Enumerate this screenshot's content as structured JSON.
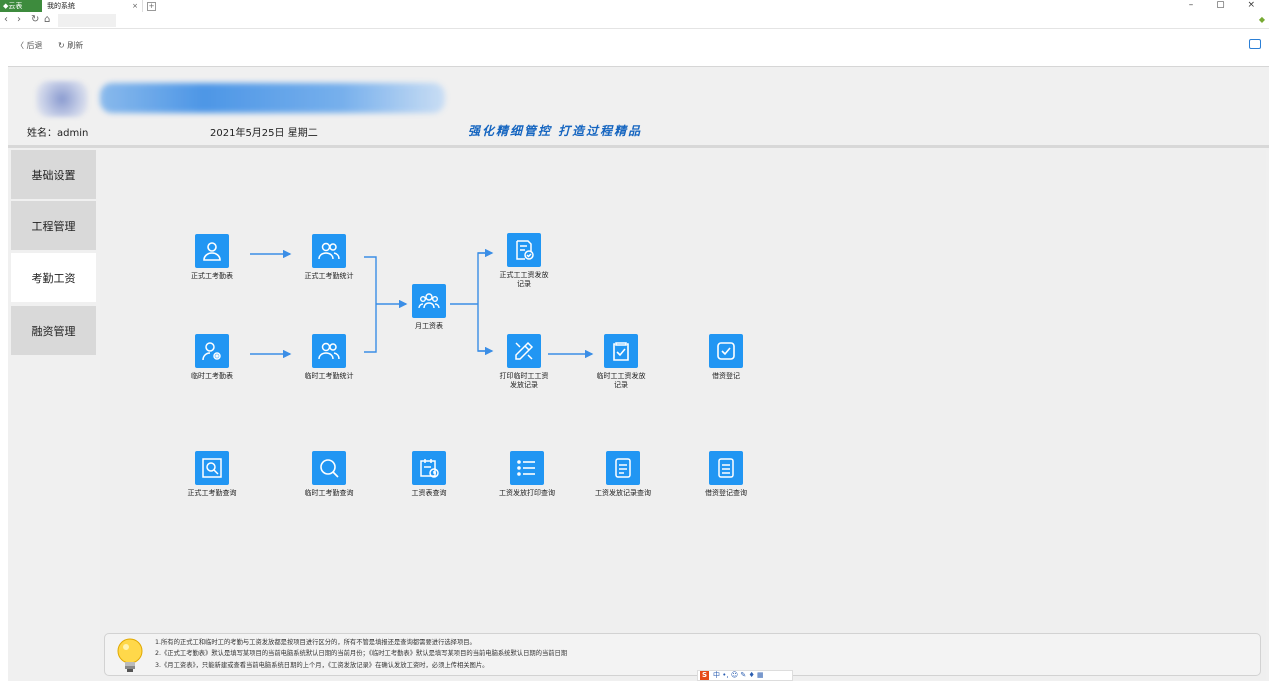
{
  "browser": {
    "tab_home": "◆云表",
    "tab_active": "我的系统",
    "tab_close": "×",
    "window_controls": "–  ▢  ×",
    "nav_back": "‹",
    "nav_forward": "›",
    "nav_refresh": "↻",
    "nav_home": "⌂",
    "toolbar_back": "〈 后退",
    "toolbar_refresh": "↻ 刷新"
  },
  "header": {
    "user_label": "姓名：admin",
    "date_label": "2021年5月25日    星期二",
    "slogan": "强化精细管控    打造过程精品"
  },
  "sidebar": {
    "items": [
      {
        "label": "基础设置"
      },
      {
        "label": "工程管理"
      },
      {
        "label": "考勤工资",
        "active": true
      },
      {
        "label": "融资管理"
      }
    ]
  },
  "flow": {
    "nodes": [
      {
        "id": "formal_attendance",
        "label": "正式工考勤表",
        "icon": "user-icon"
      },
      {
        "id": "formal_attendance_stats",
        "label": "正式工考勤统计",
        "icon": "users-icon"
      },
      {
        "id": "monthly_salary",
        "label": "月工资表",
        "icon": "group-icon"
      },
      {
        "id": "formal_payroll_record",
        "label": "正式工工资发放记录",
        "icon": "document-check-icon"
      },
      {
        "id": "temp_attendance",
        "label": "临时工考勤表",
        "icon": "user-gear-icon"
      },
      {
        "id": "temp_attendance_stats",
        "label": "临时工考勤统计",
        "icon": "users-icon"
      },
      {
        "id": "print_temp_payroll",
        "label": "打印临时工工资发放记录",
        "icon": "pencil-ruler-icon"
      },
      {
        "id": "temp_payroll_record",
        "label": "临时工工资发放记录",
        "icon": "clipboard-check-icon"
      },
      {
        "id": "loan_register",
        "label": "借资登记",
        "icon": "checkbox-icon"
      }
    ],
    "query_nodes": [
      {
        "label": "正式工考勤查询",
        "icon": "image-search-icon"
      },
      {
        "label": "临时工考勤查询",
        "icon": "search-icon"
      },
      {
        "label": "工资表查询",
        "icon": "calendar-clock-icon"
      },
      {
        "label": "工资发放打印查询",
        "icon": "list-icon"
      },
      {
        "label": "工资发放记录查询",
        "icon": "document-lines-icon"
      },
      {
        "label": "借资登记查询",
        "icon": "document-lines-icon"
      }
    ]
  },
  "notes": {
    "lines": [
      "1.所有的正式工和临时工的考勤与工资发放都是按项目进行区分的，所有不管是填报还是查询都需要进行选择项目。",
      "2.《正式工考勤表》默认是填写某项目的当前电脑系统默认日期的当前月份；《临时工考勤表》默认是填写某项目的当前电脑系统默认日期的当前日期",
      "3.《月工资表》，只能新建或查看当前电脑系统日期的上个月，《工资发放记录》在确认发放工资时，必须上传相关图片。"
    ]
  },
  "ime": {
    "label": "中 •, ☺ ✎ ♦ ▦"
  },
  "colors": {
    "accent": "#2196f3",
    "slogan": "#1565c0",
    "arrow": "#3b8ee6"
  }
}
